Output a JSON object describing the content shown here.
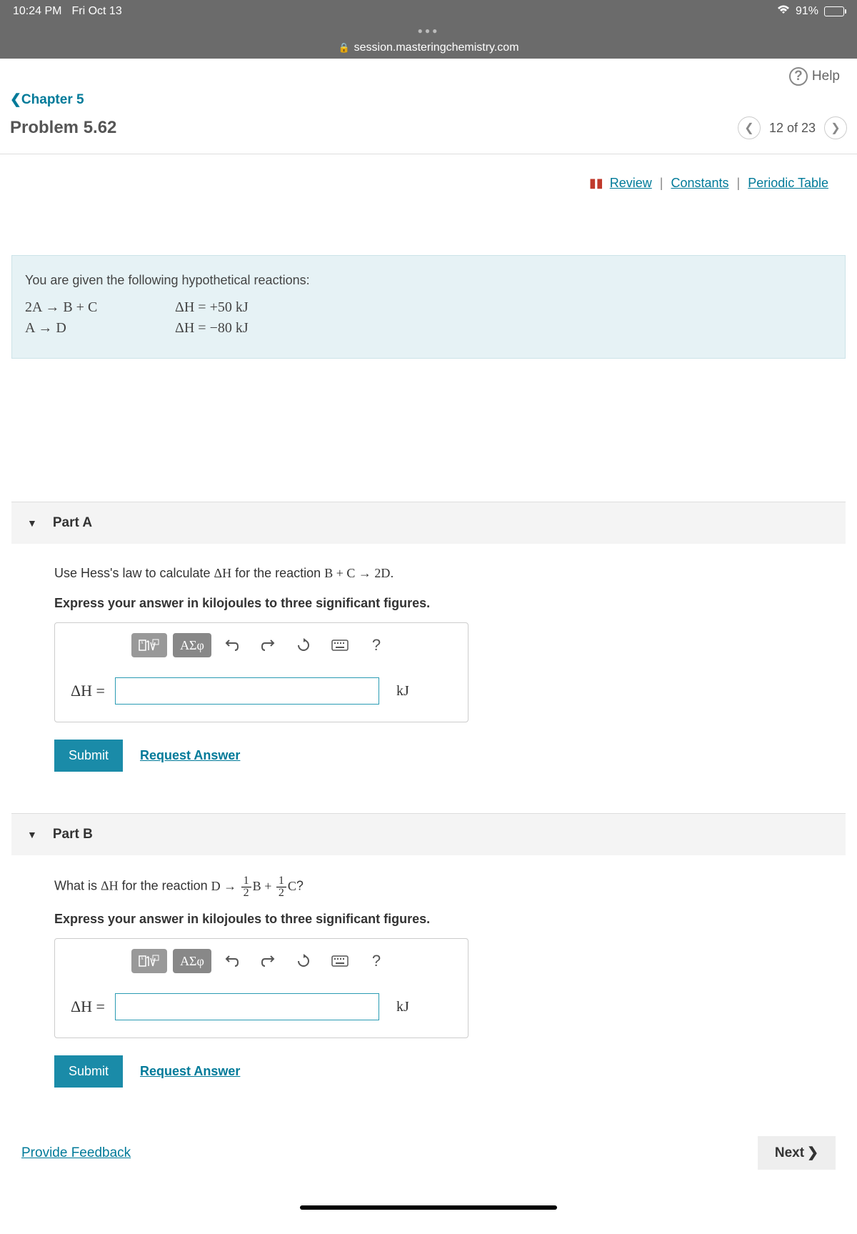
{
  "status": {
    "time": "10:24 PM",
    "date": "Fri Oct 13",
    "battery": "91%"
  },
  "url": "session.masteringchemistry.com",
  "help_label": "Help",
  "chapter_link": "Chapter 5",
  "problem_title": "Problem 5.62",
  "nav_counter": "12 of 23",
  "refs": {
    "review": "Review",
    "constants": "Constants",
    "periodic": "Periodic Table"
  },
  "given": {
    "intro": "You are given the following hypothetical reactions:",
    "rxns": [
      {
        "eq": "2A → B + C",
        "dh": "ΔH = +50 kJ"
      },
      {
        "eq": "A → D",
        "dh": "ΔH = −80 kJ"
      }
    ]
  },
  "toolbar": {
    "greek": "ΑΣφ",
    "help": "?"
  },
  "partA": {
    "title": "Part A",
    "q_prefix": "Use Hess's law to calculate ",
    "q_dH": "ΔH",
    "q_mid": " for the reaction ",
    "q_rxn": "B + C → 2D",
    "q_suffix": ".",
    "instruct": "Express your answer in kilojoules to three significant figures.",
    "label": "ΔH",
    "eq": "=",
    "unit": "kJ",
    "submit": "Submit",
    "request": "Request Answer"
  },
  "partB": {
    "title": "Part B",
    "q_prefix": "What is ",
    "q_dH": "ΔH",
    "q_mid": " for the reaction ",
    "q_rxn_left": "D → ",
    "q_rxn_b": "B",
    "q_rxn_plus": " + ",
    "q_rxn_c": "C",
    "q_suffix": "?",
    "frac_num": "1",
    "frac_den": "2",
    "instruct": "Express your answer in kilojoules to three significant figures.",
    "label": "ΔH",
    "eq": "=",
    "unit": "kJ",
    "submit": "Submit",
    "request": "Request Answer"
  },
  "footer": {
    "feedback": "Provide Feedback",
    "next": "Next"
  }
}
